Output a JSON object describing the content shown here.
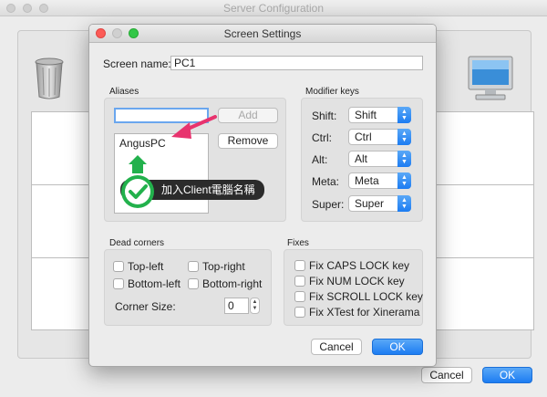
{
  "window": {
    "title": "Server Configuration",
    "cancel_label": "Cancel",
    "ok_label": "OK"
  },
  "dialog": {
    "title": "Screen Settings",
    "screen_name_label": "Screen name:",
    "screen_name_value": "PC1",
    "aliases": {
      "group_label": "Aliases",
      "input_value": "",
      "add_label": "Add",
      "remove_label": "Remove",
      "items": [
        "AngusPC"
      ]
    },
    "modifier_keys": {
      "group_label": "Modifier keys",
      "rows": [
        {
          "label": "Shift:",
          "value": "Shift"
        },
        {
          "label": "Ctrl:",
          "value": "Ctrl"
        },
        {
          "label": "Alt:",
          "value": "Alt"
        },
        {
          "label": "Meta:",
          "value": "Meta"
        },
        {
          "label": "Super:",
          "value": "Super"
        }
      ]
    },
    "dead_corners": {
      "group_label": "Dead corners",
      "top_left": "Top-left",
      "top_right": "Top-right",
      "bottom_left": "Bottom-left",
      "bottom_right": "Bottom-right",
      "corner_size_label": "Corner Size:",
      "corner_size_value": "0"
    },
    "fixes": {
      "group_label": "Fixes",
      "items": [
        "Fix CAPS LOCK key",
        "Fix NUM LOCK key",
        "Fix SCROLL LOCK key",
        "Fix XTest for Xinerama"
      ]
    },
    "cancel_label": "Cancel",
    "ok_label": "OK"
  },
  "annotation": {
    "tooltip_text": "加入Client電腦名稱"
  },
  "colors": {
    "accent_blue": "#1c7cf2",
    "annotation_pink": "#e8336e",
    "annotation_green": "#22b14c"
  }
}
